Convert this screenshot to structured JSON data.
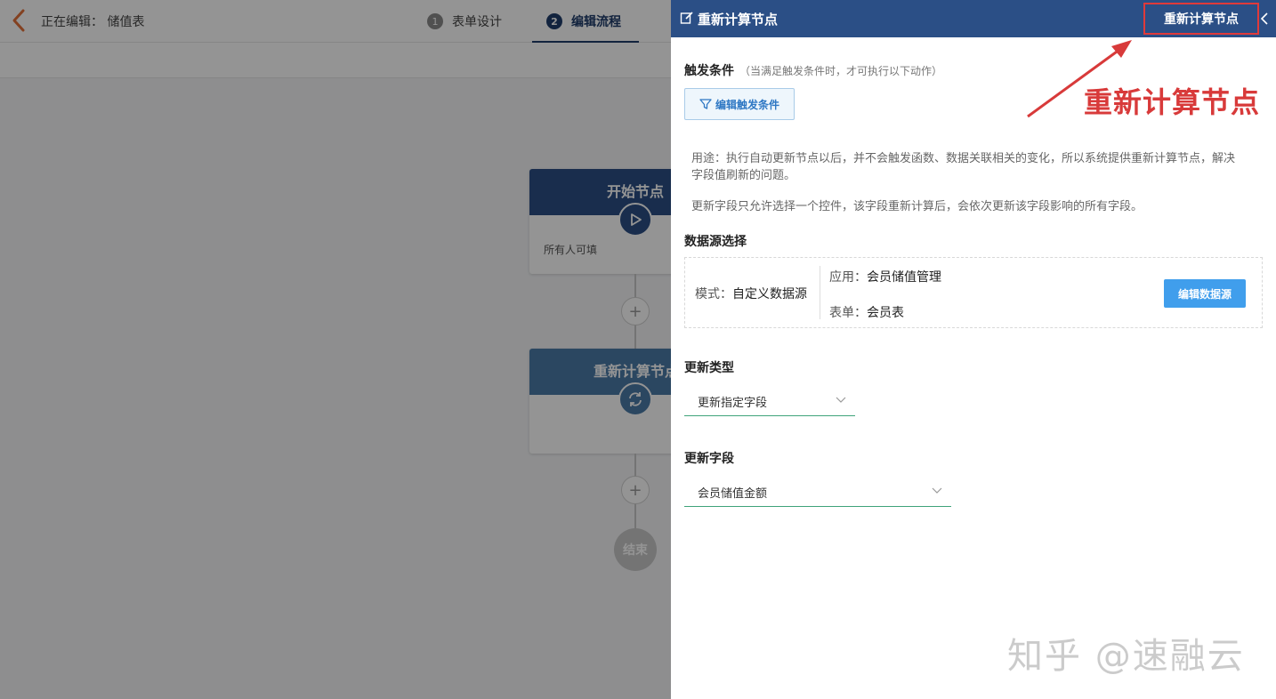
{
  "editor": {
    "editing_label": "正在编辑：  储值表",
    "steps": [
      {
        "num": "1",
        "label": "表单设计"
      },
      {
        "num": "2",
        "label": "编辑流程"
      }
    ]
  },
  "flow": {
    "start_node": {
      "title": "开始节点",
      "body": "所有人可填"
    },
    "recalc_node": {
      "title": "重新计算节点"
    },
    "add_symbol": "+",
    "end_node": "结束"
  },
  "drawer": {
    "title": "重新计算节点",
    "header_button": "重新计算节点",
    "trigger": {
      "label": "触发条件",
      "hint": "（当满足触发条件时，才可执行以下动作）",
      "button": "编辑触发条件"
    },
    "usage_text": "用途：执行自动更新节点以后，并不会触发函数、数据关联相关的变化，所以系统提供重新计算节点，解决字段值刷新的问题。",
    "rule_text": "更新字段只允许选择一个控件，该字段重新计算后，会依次更新该字段影响的所有字段。",
    "datasource": {
      "label": "数据源选择",
      "mode_label": "模式：",
      "mode_value": "自定义数据源",
      "app_label": "应用：",
      "app_value": "会员储值管理",
      "form_label": "表单：",
      "form_value": "会员表",
      "button": "编辑数据源"
    },
    "update_type": {
      "label": "更新类型",
      "value": "更新指定字段"
    },
    "update_field": {
      "label": "更新字段",
      "value": "会员储值金额"
    }
  },
  "annotation": {
    "text": "重新计算节点",
    "color": "#d83a3a"
  },
  "watermark": "知乎 @速融云",
  "colors": {
    "header": "#2b4f86",
    "primary_button": "#409eec",
    "underline": "#3fa37a"
  }
}
